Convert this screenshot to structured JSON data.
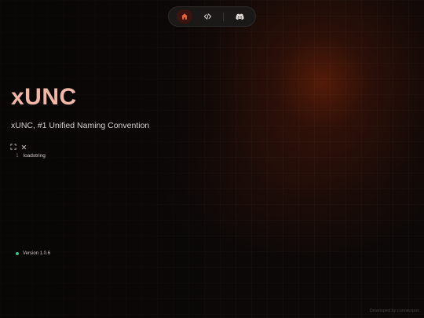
{
  "nav": {
    "items": [
      {
        "icon": "home-icon",
        "active": true
      },
      {
        "icon": "code-icon",
        "active": false
      },
      {
        "icon": "discord-icon",
        "active": false
      }
    ]
  },
  "hero": {
    "title": "xUNC",
    "subtitle": "xUNC, #1 Unified Naming Convention"
  },
  "list": {
    "items": [
      {
        "number": "1",
        "label": "loadstring"
      }
    ]
  },
  "footer": {
    "version": "Version 1.0.6",
    "credit": "Developed by cunniezpoo",
    "status_color": "#3fbf7f"
  },
  "colors": {
    "accent": "#f1b6a6",
    "active_nav_bg": "#3a1410"
  }
}
